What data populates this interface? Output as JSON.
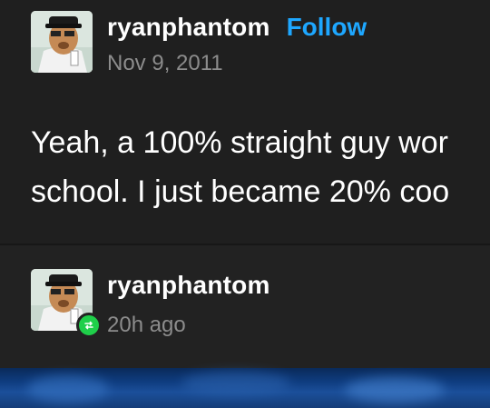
{
  "post": {
    "username": "ryanphantom",
    "follow_label": "Follow",
    "date": "Nov 9, 2011",
    "text_lines": [
      "Yeah, a 100% straight guy wor",
      "school. I just became 20% coo"
    ]
  },
  "reblog": {
    "username": "ryanphantom",
    "time_ago": "20h ago",
    "badge_icon": "reblog-icon",
    "badge_color": "#1fcf4a"
  },
  "colors": {
    "background": "#1f1f1f",
    "accent": "#1ea7ff",
    "muted": "#8c8c8c"
  }
}
